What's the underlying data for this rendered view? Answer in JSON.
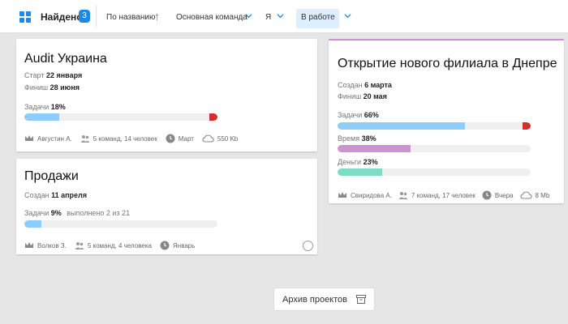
{
  "toolbar": {
    "found_label": "Найдено",
    "found_count": "3",
    "sort_label": "По названию",
    "team_filter": "Основная команда",
    "person_filter": "Я",
    "status_filter": "В работе"
  },
  "colors": {
    "accent": "#1e88e5",
    "progress_blue": "#8ecdf7",
    "progress_red": "#d32f2f",
    "time_purple": "#c994cf",
    "money_teal": "#7fdcc4",
    "card_top_border": "#c994cf"
  },
  "cards": [
    {
      "title": "Audit Украина",
      "start_label": "Старт",
      "start_value": "22 января",
      "finish_label": "Финиш",
      "finish_value": "28 июня",
      "tasks_label": "Задачи",
      "tasks_value": "18%",
      "tasks_progress": 0.18,
      "overdue": true,
      "owner": "Августин А.",
      "team": "5 команд, 14 человек",
      "month": "Март",
      "size": "550 Kb"
    },
    {
      "title": "Продажи",
      "created_label": "Создан",
      "created_value": "11 апреля",
      "tasks_label": "Задачи",
      "tasks_value": "9%",
      "tasks_extra": "выполнено 2 из 21",
      "tasks_progress": 0.09,
      "owner": "Волков З.",
      "team": "5 команд, 4 человека",
      "month": "Январь"
    },
    {
      "title": "Открытие нового филиала в Днепре",
      "created_label": "Создан",
      "created_value": "6 марта",
      "finish_label": "Финиш",
      "finish_value": "20 мая",
      "tasks_label": "Задачи",
      "tasks_value": "66%",
      "tasks_progress": 0.66,
      "overdue": true,
      "time_label": "Время",
      "time_value": "38%",
      "time_progress": 0.38,
      "money_label": "Деньги",
      "money_value": "23%",
      "money_progress": 0.23,
      "owner": "Свиридова А.",
      "team": "7 команд, 17 человек",
      "when": "Вчера",
      "size": "8 Mb"
    }
  ],
  "archive_button": "Архив проектов",
  "icons": [
    "grid-icon",
    "sort-arrow-up-icon",
    "chevron-down-icon",
    "crown-icon",
    "people-icon",
    "clock-icon",
    "cloud-icon",
    "archive-box-icon"
  ]
}
